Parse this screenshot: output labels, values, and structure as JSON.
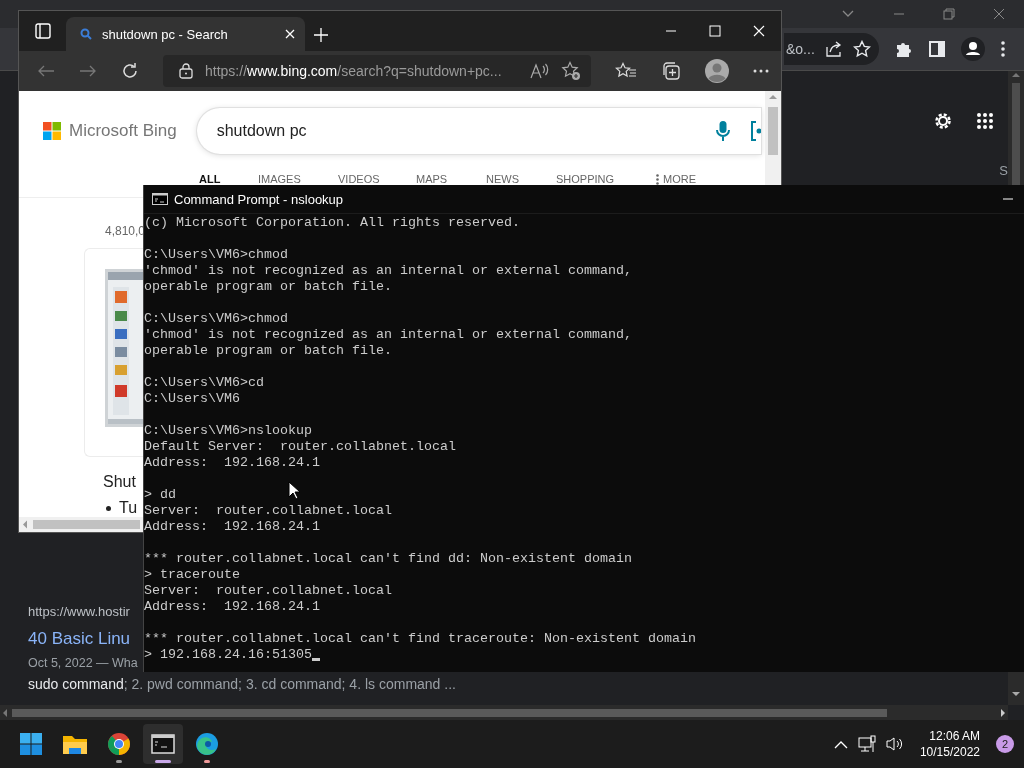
{
  "chrome_window": {
    "address_fragment": "&o...",
    "partial_heading": "S",
    "result": {
      "url": "https://www.hostir",
      "title": "40 Basic Linu",
      "date": "Oct 5, 2022 — Wha",
      "snippet": "**sudo command**; 2. pwd command; 3. cd command; 4. ls command ..."
    }
  },
  "edge_window": {
    "tab": {
      "title": "shutdown pc - Search",
      "selected": true
    },
    "url": "https://**www.bing.com**/search?q=shutdown+pc...",
    "brand": "Microsoft Bing",
    "query": "shutdown pc",
    "search_tabs": [
      {
        "label": "ALL",
        "selected": true
      },
      {
        "label": "IMAGES",
        "selected": false
      },
      {
        "label": "VIDEOS",
        "selected": false
      },
      {
        "label": "MAPS",
        "selected": false
      },
      {
        "label": "NEWS",
        "selected": false
      },
      {
        "label": "SHOPPING",
        "selected": false
      },
      {
        "label": "MORE",
        "selected": false
      }
    ],
    "result_count": "4,810,0",
    "result_title": "Shut",
    "result_bullet": "Tu"
  },
  "cmd_window": {
    "title": "Command Prompt - nslookup",
    "blocks": [
      [
        "(c) Microsoft Corporation. All rights reserved."
      ],
      [
        "C:\\Users\\VM6>chmod",
        "'chmod' is not recognized as an internal or external command,",
        "operable program or batch file."
      ],
      [
        "C:\\Users\\VM6>chmod",
        "'chmod' is not recognized as an internal or external command,",
        "operable program or batch file."
      ],
      [
        "C:\\Users\\VM6>cd",
        "C:\\Users\\VM6"
      ],
      [
        "C:\\Users\\VM6>nslookup",
        "Default Server:  router.collabnet.local",
        "Address:  192.168.24.1"
      ],
      [
        "> dd",
        "Server:  router.collabnet.local",
        "Address:  192.168.24.1"
      ],
      [
        "*** router.collabnet.local can't find dd: Non-existent domain",
        "> traceroute",
        "Server:  router.collabnet.local",
        "Address:  192.168.24.1"
      ],
      [
        "*** router.collabnet.local can't find traceroute: Non-existent domain",
        "> 192.168.24.16:51305"
      ]
    ]
  },
  "taskbar": {
    "apps": [
      {
        "kind": "start",
        "running": false,
        "active": false
      },
      {
        "kind": "explorer",
        "running": false,
        "active": false
      },
      {
        "kind": "chrome",
        "running": true,
        "active": false
      },
      {
        "kind": "terminal",
        "running": true,
        "active": true
      },
      {
        "kind": "edge",
        "running": true,
        "active": false
      }
    ],
    "time": "12:06 AM",
    "date": "10/15/2022",
    "notification_count": "2"
  }
}
